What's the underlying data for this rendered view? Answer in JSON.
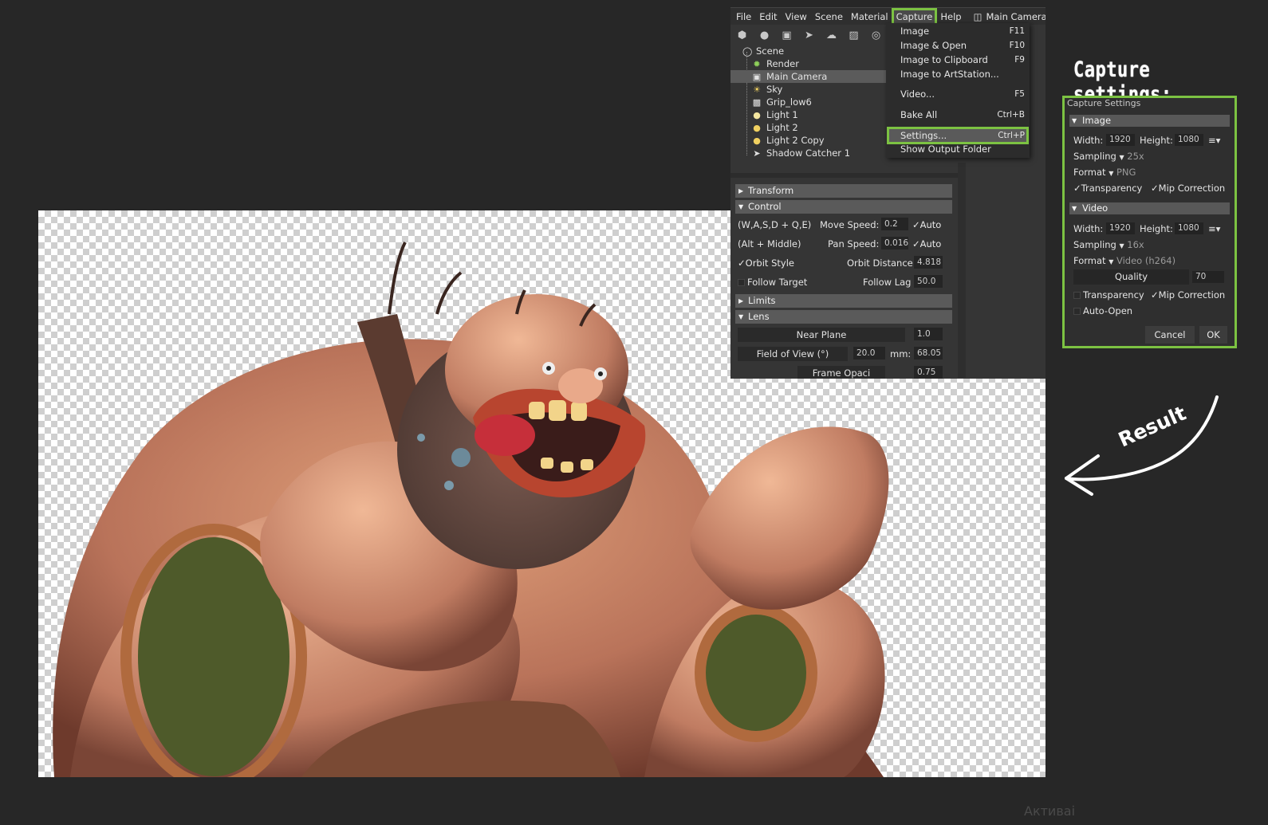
{
  "menubar": {
    "items": [
      "File",
      "Edit",
      "View",
      "Scene",
      "Material",
      "Capture",
      "Help"
    ],
    "active": "Capture",
    "camera_label": "Main Camera"
  },
  "toolbar_icons": [
    "cube-icon",
    "bulb-icon",
    "camera-icon",
    "plane-icon",
    "cloud-icon",
    "material-icon",
    "target-icon"
  ],
  "scene_tree": [
    {
      "label": "Scene",
      "icon": "scene-icon"
    },
    {
      "label": "Render",
      "icon": "gear-icon"
    },
    {
      "label": "Main Camera",
      "icon": "camera-icon",
      "selected": true
    },
    {
      "label": "Sky",
      "icon": "sky-icon"
    },
    {
      "label": "Grip_low6",
      "icon": "mesh-icon"
    },
    {
      "label": "Light 1",
      "icon": "bulb-icon"
    },
    {
      "label": "Light 2",
      "icon": "bulb-icon"
    },
    {
      "label": "Light 2 Copy",
      "icon": "bulb-icon"
    },
    {
      "label": "Shadow Catcher 1",
      "icon": "shadow-icon"
    }
  ],
  "props": {
    "transform": "Transform",
    "control": "Control",
    "wasd": "(W,A,S,D + Q,E)",
    "move_speed_label": "Move Speed:",
    "move_speed": "0.2",
    "auto": "Auto",
    "alt_middle": "(Alt + Middle)",
    "pan_speed_label": "Pan Speed:",
    "pan_speed": "0.016",
    "orbit_style": "Orbit Style",
    "orbit_distance_label": "Orbit Distance:",
    "orbit_distance": "4.818",
    "follow_target": "Follow Target",
    "follow_lag_label": "Follow Lag",
    "follow_lag": "50.0",
    "limits": "Limits",
    "lens": "Lens",
    "near_plane_label": "Near Plane",
    "near_plane": "1.0",
    "fov_label": "Field of View (°)",
    "fov": "20.0",
    "mm_label": "mm:",
    "mm": "68.05",
    "frame_opacity_label": "Frame Opaci",
    "frame_opacity": "0.75"
  },
  "capture_menu": [
    {
      "label": "Image",
      "shortcut": "F11"
    },
    {
      "label": "Image & Open",
      "shortcut": "F10"
    },
    {
      "label": "Image to Clipboard",
      "shortcut": "F9"
    },
    {
      "label": "Image to ArtStation...",
      "shortcut": ""
    },
    {
      "label": "Video...",
      "shortcut": "F5"
    },
    {
      "label": "Bake All",
      "shortcut": "Ctrl+B"
    },
    {
      "label": "Settings...",
      "shortcut": "Ctrl+P",
      "highlighted": true
    },
    {
      "label": "Show Output Folder",
      "shortcut": ""
    }
  ],
  "annotation_title": "Capture settings:",
  "annotation_result": "Result",
  "dialog": {
    "title": "Capture Settings",
    "image_section": "Image",
    "width_label": "Width:",
    "height_label": "Height:",
    "image_width": "1920",
    "image_height": "1080",
    "sampling_label": "Sampling",
    "image_sampling": "25x",
    "format_label": "Format",
    "image_format": "PNG",
    "transparency": "Transparency",
    "mip_correction": "Mip Correction",
    "video_section": "Video",
    "video_width": "1920",
    "video_height": "1080",
    "video_sampling": "16x",
    "video_format": "Video (h264)",
    "quality_label": "Quality",
    "quality": "70",
    "auto_open": "Auto-Open",
    "cancel": "Cancel",
    "ok": "OK",
    "image_transparency_checked": true,
    "image_mip_checked": true,
    "video_transparency_checked": false,
    "video_mip_checked": true,
    "auto_open_checked": false
  },
  "colors": {
    "accent_green": "#7cc242",
    "panel_bg": "#353535",
    "page_bg": "#272727"
  },
  "watermark": "Активаі"
}
